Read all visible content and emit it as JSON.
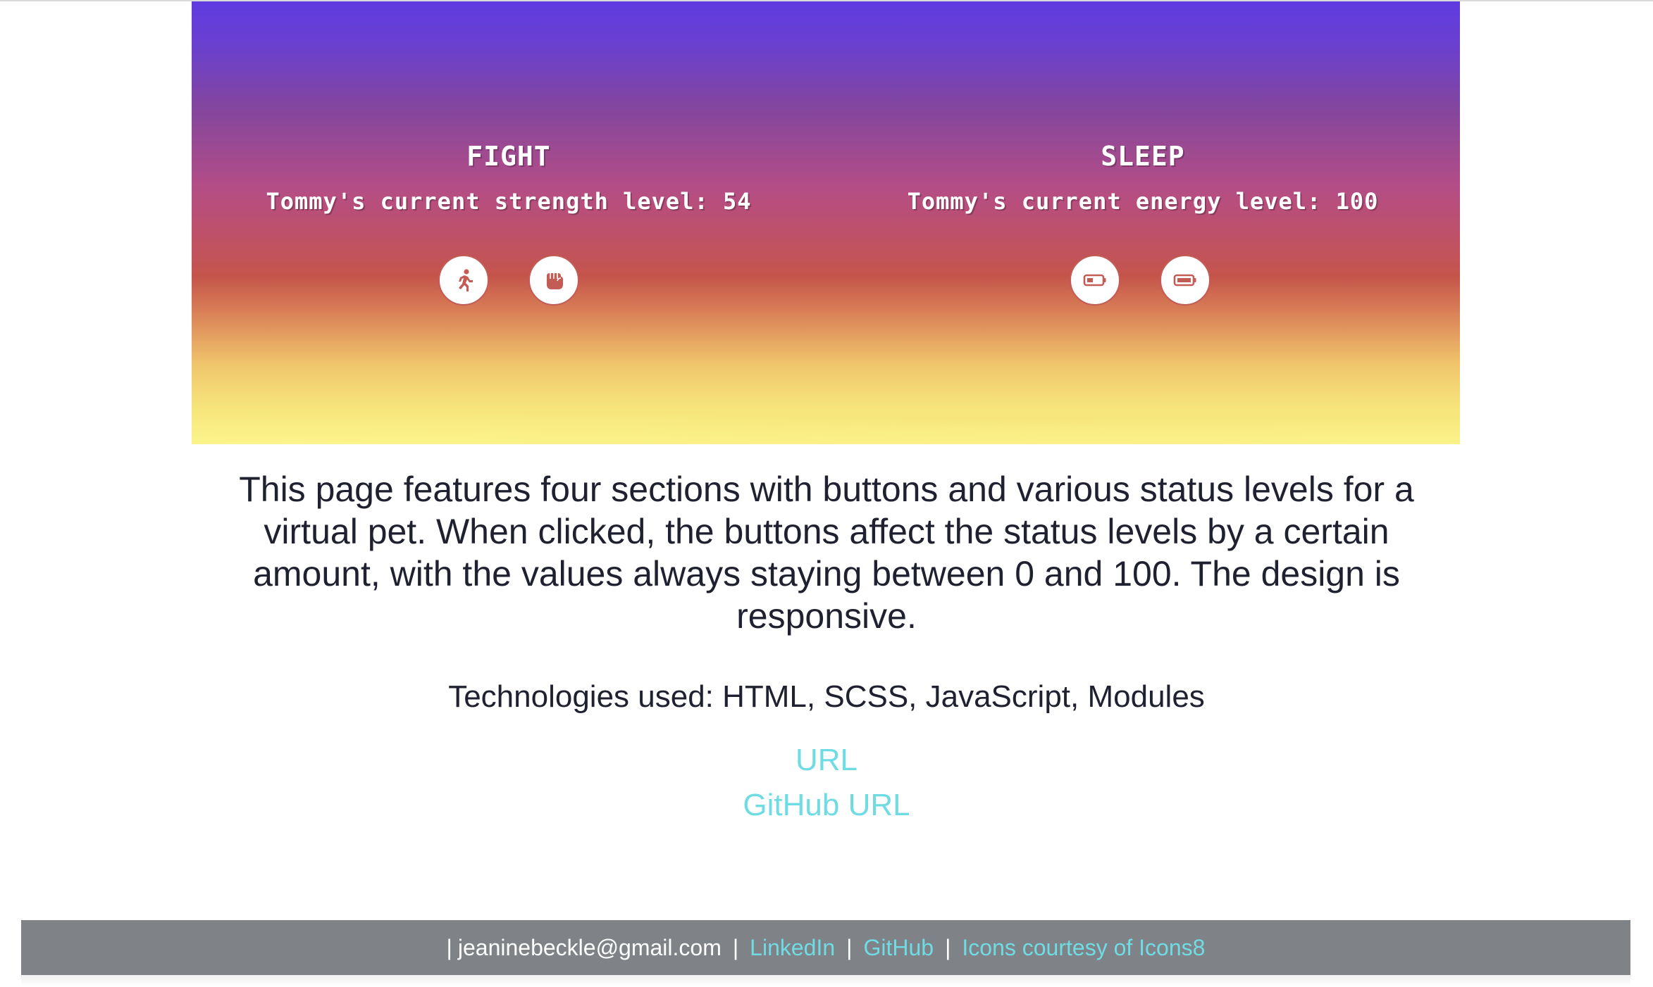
{
  "sections": {
    "fight": {
      "title": "FIGHT",
      "status": "Tommy's current strength level: 54",
      "buttons": [
        {
          "icon": "running-person-icon"
        },
        {
          "icon": "fist-icon"
        }
      ]
    },
    "sleep": {
      "title": "SLEEP",
      "status": "Tommy's current energy level: 100",
      "buttons": [
        {
          "icon": "battery-low-icon"
        },
        {
          "icon": "battery-full-icon"
        }
      ]
    }
  },
  "description": "This page features four sections with buttons and various status levels for a virtual pet. When clicked, the buttons affect the status levels by a certain amount, with the values always staying between 0 and 100. The design is responsive.",
  "technologies": "Technologies used: HTML, SCSS, JavaScript, Modules",
  "links": {
    "url": "URL",
    "github_url": "GitHub URL"
  },
  "footer": {
    "lead_sep": "|",
    "email": "jeaninebeckle@gmail.com",
    "sep": "|",
    "linkedin": "LinkedIn",
    "github": "GitHub",
    "icons_credit": "Icons courtesy of Icons8"
  },
  "colors": {
    "link": "#6fdce3",
    "icon_accent": "#c35c55",
    "footer_bg": "#7f8387",
    "text": "#1f2130"
  }
}
